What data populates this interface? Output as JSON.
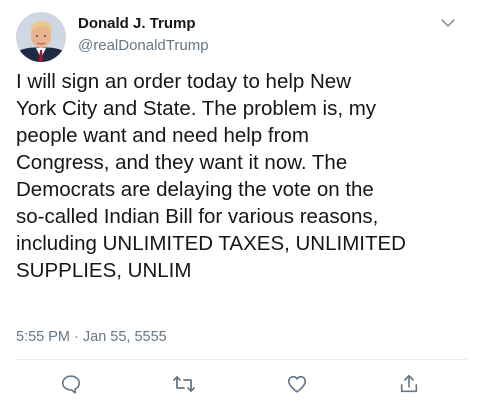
{
  "author": {
    "name": "Donald J. Trump",
    "handle": "@realDonaldTrump",
    "avatar_icon": "profile-photo"
  },
  "tweet": {
    "text": "I will sign an order today to help New\nYork City and State. The problem is, my\npeople want and need help from\nCongress, and they want it now. The\nDemocrats are delaying the vote on the\nso-called Indian Bill for various reasons,\nincluding UNLIMITED TAXES, UNLIMITED\nSUPPLIES, UNLIM",
    "timestamp": "5:55 PM · Jan 55, 5555"
  },
  "actions": [
    {
      "name": "reply",
      "icon": "speech-bubble-icon"
    },
    {
      "name": "retweet",
      "icon": "retweet-icon"
    },
    {
      "name": "like",
      "icon": "heart-icon"
    },
    {
      "name": "share",
      "icon": "share-icon"
    }
  ],
  "colors": {
    "text": "#14171a",
    "secondary": "#657786",
    "divider": "#e6ecf0",
    "icon": "#657786"
  }
}
